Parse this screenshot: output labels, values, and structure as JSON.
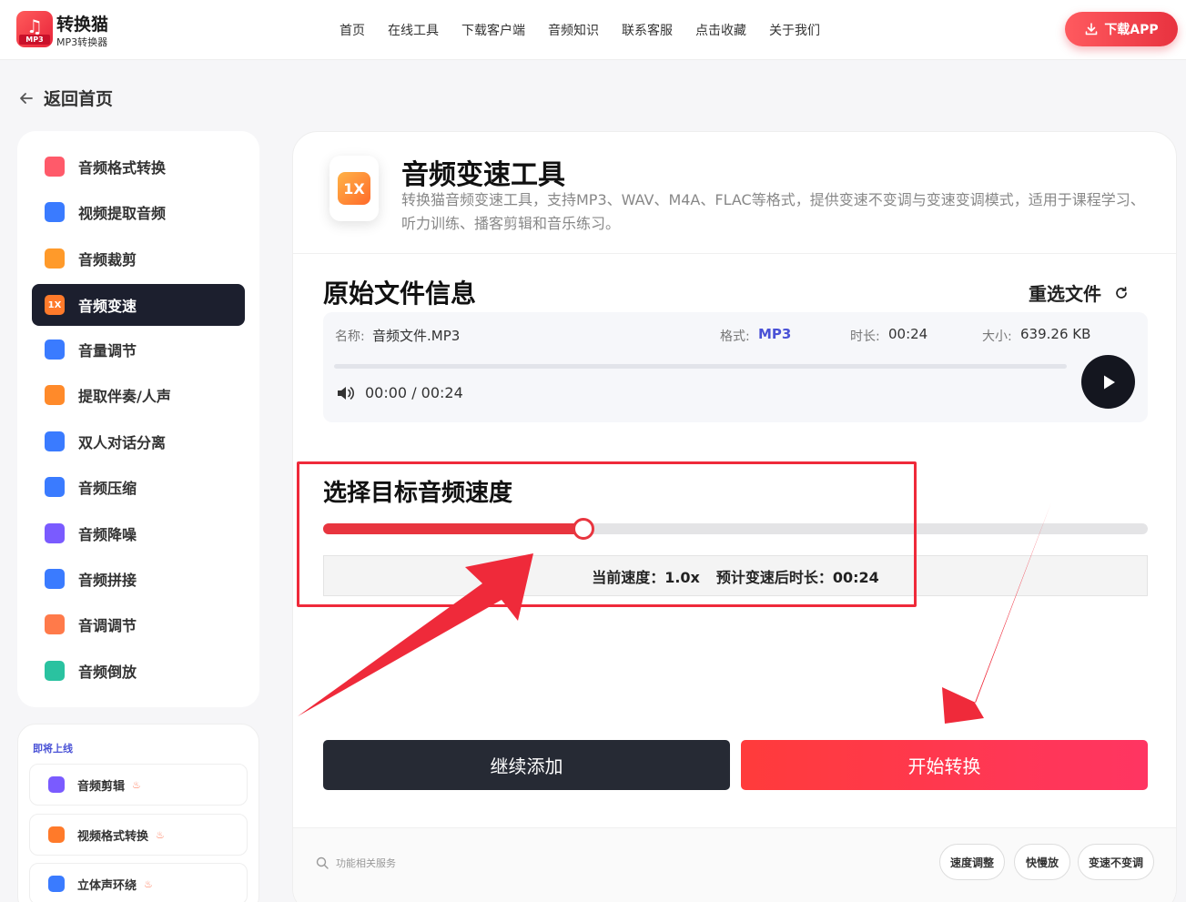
{
  "header": {
    "logo_badge": "MP3",
    "brand_name": "转换猫",
    "brand_sub": "MP3转换器",
    "nav": [
      "首页",
      "在线工具",
      "下载客户端",
      "音频知识",
      "联系客服",
      "点击收藏",
      "关于我们"
    ],
    "download_label": "下载APP"
  },
  "back_label": "返回首页",
  "sidebar": {
    "items": [
      {
        "label": "音频格式转换",
        "icon": "audio-format-icon",
        "color": "#ff5a6a"
      },
      {
        "label": "视频提取音频",
        "icon": "video-extract-icon",
        "color": "#3a7bff"
      },
      {
        "label": "音频裁剪",
        "icon": "audio-cut-icon",
        "color": "#ff9a2a"
      },
      {
        "label": "音频变速",
        "icon": "audio-speed-icon",
        "color": "#ff7a2a",
        "badge": "1X",
        "active": true
      },
      {
        "label": "音量调节",
        "icon": "volume-icon",
        "color": "#3a7bff"
      },
      {
        "label": "提取伴奏/人声",
        "icon": "vocal-extract-icon",
        "color": "#ff8a2a"
      },
      {
        "label": "双人对话分离",
        "icon": "dialog-split-icon",
        "color": "#3a7bff"
      },
      {
        "label": "音频压缩",
        "icon": "audio-compress-icon",
        "color": "#3a7bff"
      },
      {
        "label": "音频降噪",
        "icon": "noise-reduce-icon",
        "color": "#7a5bff"
      },
      {
        "label": "音频拼接",
        "icon": "audio-merge-icon",
        "color": "#3a7bff"
      },
      {
        "label": "音调调节",
        "icon": "pitch-icon",
        "color": "#ff7a4a"
      },
      {
        "label": "音频倒放",
        "icon": "audio-reverse-icon",
        "color": "#2ac2a0"
      }
    ],
    "soon_title": "即将上线",
    "soon_items": [
      {
        "label": "音频剪辑",
        "icon": "scissors-icon",
        "color": "#7a5bff"
      },
      {
        "label": "视频格式转换",
        "icon": "video-format-icon",
        "color": "#ff7a2a"
      },
      {
        "label": "立体声环绕",
        "icon": "stereo-icon",
        "color": "#3a7bff"
      }
    ]
  },
  "tool": {
    "icon_text": "1X",
    "title": "音频变速工具",
    "desc": "转换猫音频变速工具，支持MP3、WAV、M4A、FLAC等格式，提供变速不变调与变速变调模式，适用于课程学习、听力训练、播客剪辑和音乐练习。"
  },
  "file": {
    "section_title": "原始文件信息",
    "reselect_label": "重选文件",
    "name_label": "名称:",
    "name_value": "音频文件.MP3",
    "format_label": "格式:",
    "format_value": "MP3",
    "duration_label": "时长:",
    "duration_value": "00:24",
    "size_label": "大小:",
    "size_value": "639.26 KB",
    "playback_time": "00:00 / 00:24",
    "progress": 0
  },
  "speed": {
    "title": "选择目标音频速度",
    "slider_fraction": 0.316,
    "current_label": "当前速度：1.0x",
    "estimate_label": "预计变速后时长：00:24"
  },
  "actions": {
    "add_label": "继续添加",
    "start_label": "开始转换"
  },
  "related": {
    "label": "功能相关服务",
    "chips": [
      "速度调整",
      "快慢放",
      "变速不变调"
    ]
  },
  "colors": {
    "accent": "#e8353f",
    "annotation": "#ef2a3a",
    "dark": "#1c1f2e"
  }
}
